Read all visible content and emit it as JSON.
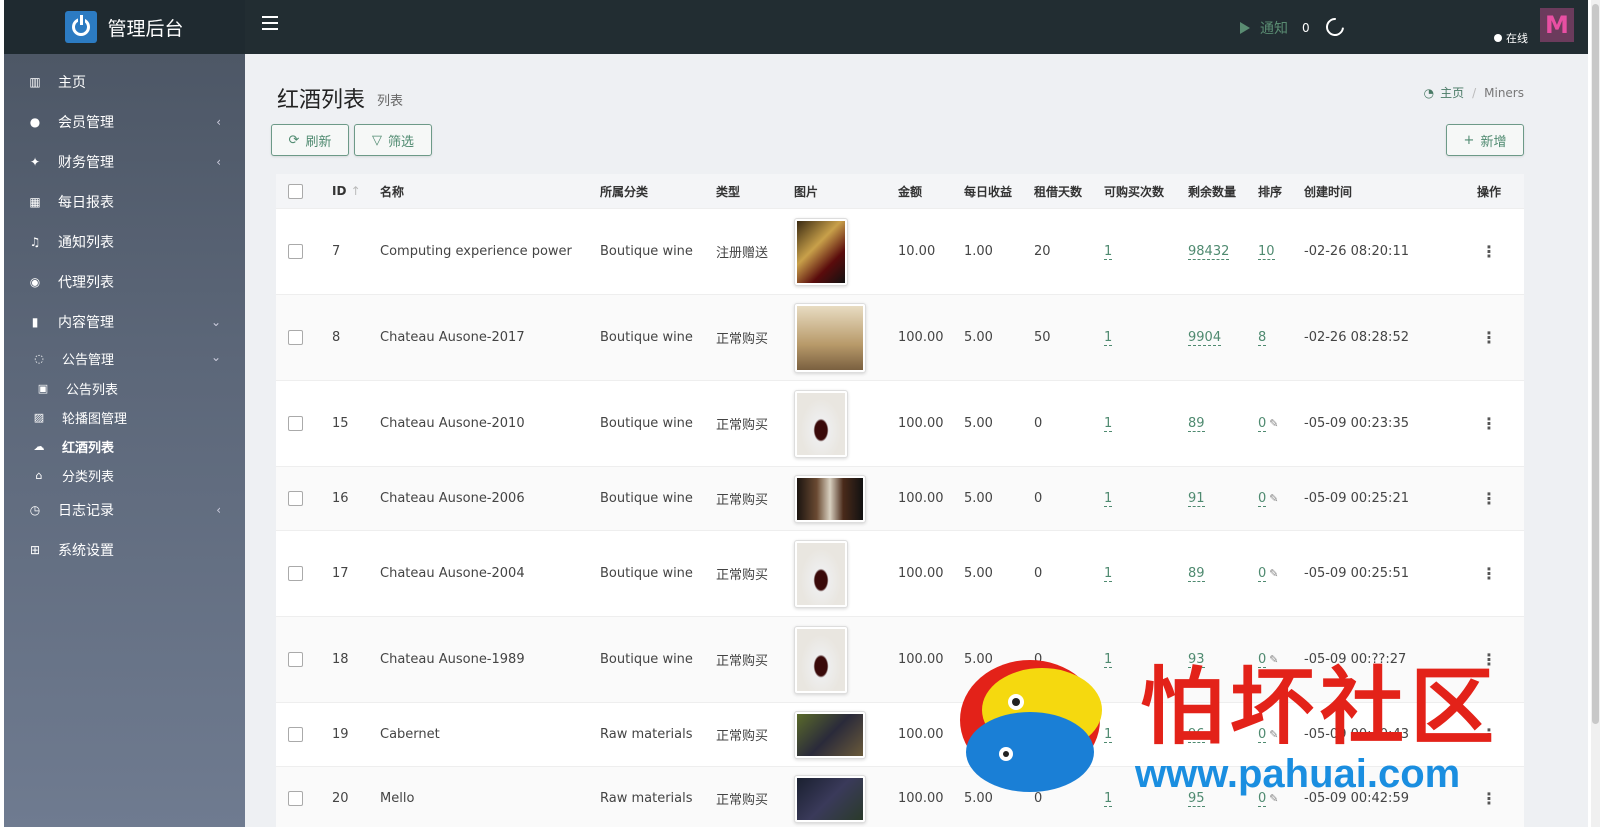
{
  "header": {
    "brand": "管理后台",
    "notify_label": "通知",
    "notify_count": "0",
    "user_status": "在线",
    "avatar_letter": "M"
  },
  "sidebar": {
    "items": [
      {
        "label": "主页",
        "icon": "bar-chart-icon"
      },
      {
        "label": "会员管理",
        "icon": "user-icon",
        "arrow": "‹"
      },
      {
        "label": "财务管理",
        "icon": "finance-icon",
        "arrow": "‹"
      },
      {
        "label": "每日报表",
        "icon": "calendar-icon"
      },
      {
        "label": "通知列表",
        "icon": "bell-icon"
      },
      {
        "label": "代理列表",
        "icon": "agent-icon"
      },
      {
        "label": "内容管理",
        "icon": "bookmark-icon",
        "arrow": "⌄"
      }
    ],
    "sub": [
      {
        "label": "公告管理",
        "icon": "comments-icon",
        "arrow": "⌄"
      },
      {
        "label": "公告列表",
        "icon": "card-icon"
      },
      {
        "label": "轮播图管理",
        "icon": "image-icon"
      },
      {
        "label": "红酒列表",
        "icon": "cloud-icon"
      },
      {
        "label": "分类列表",
        "icon": "category-icon"
      }
    ],
    "bottom": [
      {
        "label": "日志记录",
        "icon": "clock-icon",
        "arrow": "‹"
      },
      {
        "label": "系统设置",
        "icon": "windows-icon"
      }
    ]
  },
  "page": {
    "title": "红酒列表",
    "subtitle": "列表",
    "breadcrumb_home": "主页",
    "breadcrumb_current": "Miners"
  },
  "toolbar": {
    "refresh_label": "刷新",
    "filter_label": "筛选",
    "add_label": "新增"
  },
  "table": {
    "headers": [
      "ID",
      "名称",
      "所属分类",
      "类型",
      "图片",
      "金额",
      "每日收益",
      "租借天数",
      "可购买次数",
      "剩余数量",
      "排序",
      "创建时间",
      "操作"
    ],
    "rows": [
      {
        "id": "7",
        "name": "Computing experience power",
        "category": "Boutique wine",
        "type": "注册赠送",
        "image": "wine-glass",
        "amount": "10.00",
        "daily": "1.00",
        "days": "20",
        "buy": "1",
        "remaining": "98432",
        "sort": "10",
        "created": "-02-26 08:20:11"
      },
      {
        "id": "8",
        "name": "Chateau Ausone-2017",
        "category": "Boutique wine",
        "type": "正常购买",
        "image": "wine-box",
        "amount": "100.00",
        "daily": "5.00",
        "days": "50",
        "buy": "1",
        "remaining": "9904",
        "sort": "8",
        "created": "-02-26 08:28:52"
      },
      {
        "id": "15",
        "name": "Chateau Ausone-2010",
        "category": "Boutique wine",
        "type": "正常购买",
        "image": "bottle",
        "amount": "100.00",
        "daily": "5.00",
        "days": "0",
        "buy": "1",
        "remaining": "89",
        "sort": "0",
        "created": "-05-09 00:23:35"
      },
      {
        "id": "16",
        "name": "Chateau Ausone-2006",
        "category": "Boutique wine",
        "type": "正常购买",
        "image": "cellar",
        "amount": "100.00",
        "daily": "5.00",
        "days": "0",
        "buy": "1",
        "remaining": "91",
        "sort": "0",
        "created": "-05-09 00:25:21"
      },
      {
        "id": "17",
        "name": "Chateau Ausone-2004",
        "category": "Boutique wine",
        "type": "正常购买",
        "image": "bottle",
        "amount": "100.00",
        "daily": "5.00",
        "days": "0",
        "buy": "1",
        "remaining": "89",
        "sort": "0",
        "created": "-05-09 00:25:51"
      },
      {
        "id": "18",
        "name": "Chateau Ausone-1989",
        "category": "Boutique wine",
        "type": "正常购买",
        "image": "bottle",
        "amount": "100.00",
        "daily": "5.00",
        "days": "0",
        "buy": "1",
        "remaining": "93",
        "sort": "0",
        "created": "-05-09 00:??:27"
      },
      {
        "id": "19",
        "name": "Cabernet",
        "category": "Raw materials",
        "type": "正常购买",
        "image": "grapes",
        "amount": "100.00",
        "daily": "5.00",
        "days": "0",
        "buy": "1",
        "remaining": "96",
        "sort": "0",
        "created": "-05-09 00:40:43"
      },
      {
        "id": "20",
        "name": "Mello",
        "category": "Raw materials",
        "type": "正常购买",
        "image": "grapes-dark",
        "amount": "100.00",
        "daily": "5.00",
        "days": "0",
        "buy": "1",
        "remaining": "95",
        "sort": "0",
        "created": "-05-09 00:42:59"
      }
    ]
  },
  "watermark": {
    "cn": "怕坏社区",
    "url": "www.pahuai.com"
  }
}
